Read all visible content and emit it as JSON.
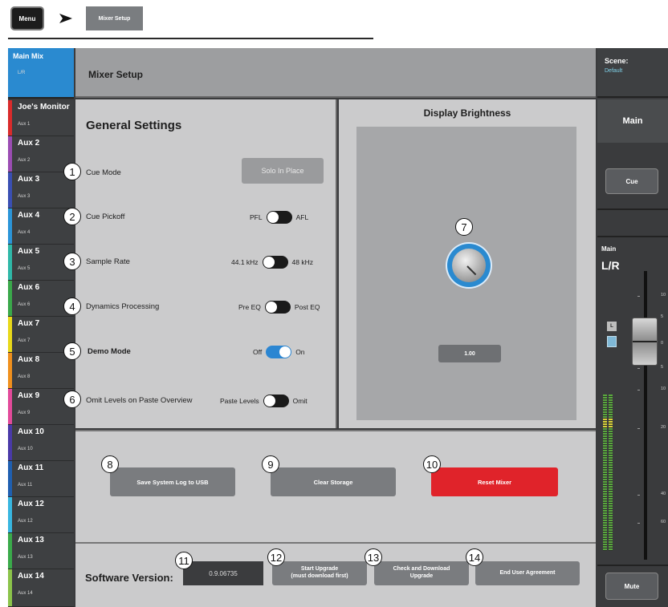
{
  "breadcrumb": {
    "menu_label": "Menu",
    "page_label": "Mixer Setup"
  },
  "channels": [
    {
      "name": "Main Mix",
      "sub": "L/R",
      "color": "#2a8ad0"
    },
    {
      "name": "Joe's Monitor",
      "sub": "Aux 1",
      "color": "#d92b2b"
    },
    {
      "name": "Aux 2",
      "sub": "Aux 2",
      "color": "#9b4db3"
    },
    {
      "name": "Aux 3",
      "sub": "Aux 3",
      "color": "#3a4fb3"
    },
    {
      "name": "Aux 4",
      "sub": "Aux 4",
      "color": "#2b95d8"
    },
    {
      "name": "Aux 5",
      "sub": "Aux 5",
      "color": "#2fb8a8"
    },
    {
      "name": "Aux 6",
      "sub": "Aux 6",
      "color": "#3aa84a"
    },
    {
      "name": "Aux 7",
      "sub": "Aux 7",
      "color": "#e8d81a"
    },
    {
      "name": "Aux 8",
      "sub": "Aux 8",
      "color": "#f0901d"
    },
    {
      "name": "Aux 9",
      "sub": "Aux 9",
      "color": "#e24a9a"
    },
    {
      "name": "Aux 10",
      "sub": "Aux 10",
      "color": "#4a3aa8"
    },
    {
      "name": "Aux 11",
      "sub": "Aux 11",
      "color": "#1f5fb0"
    },
    {
      "name": "Aux 12",
      "sub": "Aux 12",
      "color": "#38b6e0"
    },
    {
      "name": "Aux 13",
      "sub": "Aux 13",
      "color": "#3aaa4a"
    },
    {
      "name": "Aux 14",
      "sub": "Aux 14",
      "color": "#8bc34a"
    }
  ],
  "header": {
    "title": "Mixer Setup"
  },
  "general": {
    "title": "General Settings",
    "cue_mode_label": "Cue Mode",
    "cue_mode_value": "Solo In Place",
    "cue_pickoff_label": "Cue Pickoff",
    "cue_pickoff_left": "PFL",
    "cue_pickoff_right": "AFL",
    "sample_rate_label": "Sample Rate",
    "sample_rate_left": "44.1 kHz",
    "sample_rate_right": "48 kHz",
    "dynamics_label": "Dynamics Processing",
    "dynamics_left": "Pre EQ",
    "dynamics_right": "Post EQ",
    "demo_label": "Demo Mode",
    "demo_left": "Off",
    "demo_right": "On",
    "omit_label": "Omit Levels on Paste Overview",
    "omit_left": "Paste Levels",
    "omit_right": "Omit"
  },
  "brightness": {
    "title": "Display Brightness",
    "value": "1.00"
  },
  "utilities": {
    "save_log": "Save System Log to USB",
    "clear_storage": "Clear Storage",
    "reset_mixer": "Reset Mixer",
    "reset_color": "#e0232a"
  },
  "software": {
    "label": "Software Version:",
    "version": "0.9.06735",
    "start_upgrade_1": "Start Upgrade",
    "start_upgrade_2": "(must download first)",
    "check_download_1": "Check and Download",
    "check_download_2": "Upgrade",
    "eula": "End User Agreement"
  },
  "right_strip": {
    "scene_title": "Scene:",
    "scene_value": "Default",
    "main_label": "Main",
    "cue_label": "Cue",
    "fader_label": "Main",
    "fader_name": "L/R",
    "l_label": "L",
    "mute_label": "Mute",
    "scale": [
      "10",
      "5",
      "0",
      "5",
      "10",
      "20",
      "40",
      "60"
    ]
  },
  "callouts": [
    "1",
    "2",
    "3",
    "4",
    "5",
    "6",
    "7",
    "8",
    "9",
    "10",
    "11",
    "12",
    "13",
    "14"
  ]
}
